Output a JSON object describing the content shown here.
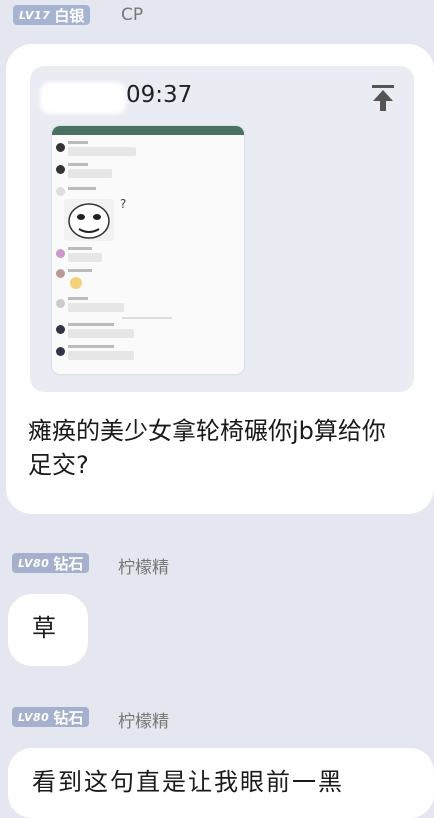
{
  "post1": {
    "level": "LV17",
    "rank": "白银",
    "username": "CP",
    "file_card": {
      "time": "09:37",
      "pin_icon": "upload-top-icon"
    },
    "message": "瘫痪的美少女拿轮椅碾你jb算给你足交?"
  },
  "post2": {
    "level": "LV80",
    "rank": "钻石",
    "username": "柠檬精",
    "message": "草"
  },
  "post3": {
    "level": "LV80",
    "rank": "钻石",
    "username": "柠檬精",
    "message": "看到这句直是让我眼前一黑"
  },
  "colors": {
    "badge_silver": "#a6b4d2",
    "badge_diamond": "#a5b0cc",
    "background": "#e4e7ef",
    "bubble": "#ffffff",
    "card": "#e9ecf3"
  }
}
